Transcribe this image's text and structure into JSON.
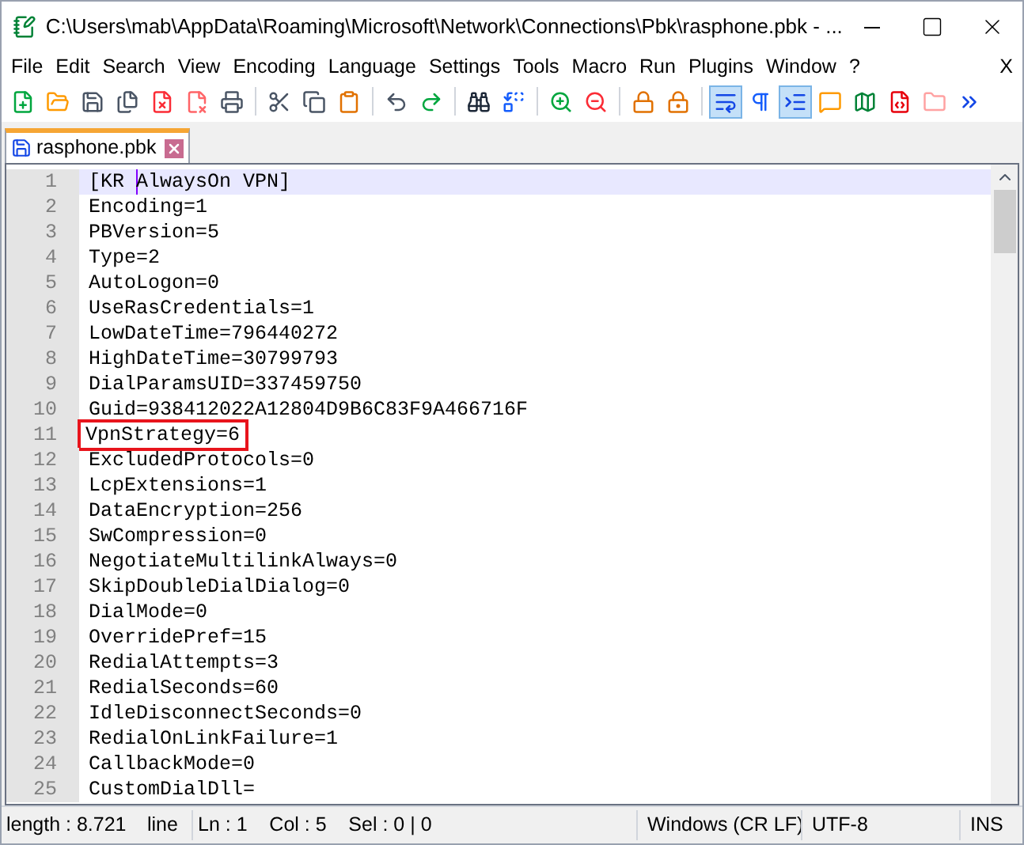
{
  "window": {
    "title": "C:\\Users\\mab\\AppData\\Roaming\\Microsoft\\Network\\Connections\\Pbk\\rasphone.pbk - ..."
  },
  "menu": [
    "File",
    "Edit",
    "Search",
    "View",
    "Encoding",
    "Language",
    "Settings",
    "Tools",
    "Macro",
    "Run",
    "Plugins",
    "Window",
    "?"
  ],
  "menu_close": "X",
  "toolbar": [
    {
      "kind": "new",
      "pressed": false
    },
    {
      "kind": "open",
      "pressed": false
    },
    {
      "kind": "save",
      "pressed": false
    },
    {
      "kind": "save-all",
      "pressed": false
    },
    {
      "kind": "close",
      "pressed": false
    },
    {
      "kind": "close-all",
      "pressed": false
    },
    {
      "kind": "print",
      "pressed": false
    },
    {
      "kind": "separator"
    },
    {
      "kind": "cut",
      "pressed": false
    },
    {
      "kind": "copy",
      "pressed": false
    },
    {
      "kind": "paste",
      "pressed": false
    },
    {
      "kind": "separator"
    },
    {
      "kind": "undo",
      "pressed": false
    },
    {
      "kind": "redo",
      "pressed": false
    },
    {
      "kind": "separator"
    },
    {
      "kind": "find",
      "pressed": false
    },
    {
      "kind": "replace",
      "pressed": false
    },
    {
      "kind": "separator"
    },
    {
      "kind": "zoom-in",
      "pressed": false
    },
    {
      "kind": "zoom-out",
      "pressed": false
    },
    {
      "kind": "separator"
    },
    {
      "kind": "sync-v",
      "pressed": false
    },
    {
      "kind": "sync-h",
      "pressed": false
    },
    {
      "kind": "separator"
    },
    {
      "kind": "wrap",
      "pressed": true
    },
    {
      "kind": "pilcrow",
      "pressed": false
    },
    {
      "kind": "indent",
      "pressed": true
    },
    {
      "kind": "lang",
      "pressed": false
    },
    {
      "kind": "map",
      "pressed": false
    },
    {
      "kind": "function",
      "pressed": false
    },
    {
      "kind": "folder",
      "pressed": false
    },
    {
      "kind": "more",
      "pressed": false
    }
  ],
  "tabs": [
    {
      "label": "rasphone.pbk",
      "selected": true
    }
  ],
  "lines": [
    {
      "number": "1",
      "text": "[KR AlwaysOn VPN]",
      "current": true,
      "boxed": false
    },
    {
      "number": "2",
      "text": "Encoding=1",
      "current": false,
      "boxed": false
    },
    {
      "number": "3",
      "text": "PBVersion=5",
      "current": false,
      "boxed": false
    },
    {
      "number": "4",
      "text": "Type=2",
      "current": false,
      "boxed": false
    },
    {
      "number": "5",
      "text": "AutoLogon=0",
      "current": false,
      "boxed": false
    },
    {
      "number": "6",
      "text": "UseRasCredentials=1",
      "current": false,
      "boxed": false
    },
    {
      "number": "7",
      "text": "LowDateTime=796440272",
      "current": false,
      "boxed": false
    },
    {
      "number": "8",
      "text": "HighDateTime=30799793",
      "current": false,
      "boxed": false
    },
    {
      "number": "9",
      "text": "DialParamsUID=337459750",
      "current": false,
      "boxed": false
    },
    {
      "number": "10",
      "text": "Guid=938412022A12804D9B6C83F9A466716F",
      "current": false,
      "boxed": false
    },
    {
      "number": "11",
      "text": "VpnStrategy=6",
      "current": false,
      "boxed": true
    },
    {
      "number": "12",
      "text": "ExcludedProtocols=0",
      "current": false,
      "boxed": false
    },
    {
      "number": "13",
      "text": "LcpExtensions=1",
      "current": false,
      "boxed": false
    },
    {
      "number": "14",
      "text": "DataEncryption=256",
      "current": false,
      "boxed": false
    },
    {
      "number": "15",
      "text": "SwCompression=0",
      "current": false,
      "boxed": false
    },
    {
      "number": "16",
      "text": "NegotiateMultilinkAlways=0",
      "current": false,
      "boxed": false
    },
    {
      "number": "17",
      "text": "SkipDoubleDialDialog=0",
      "current": false,
      "boxed": false
    },
    {
      "number": "18",
      "text": "DialMode=0",
      "current": false,
      "boxed": false
    },
    {
      "number": "19",
      "text": "OverridePref=15",
      "current": false,
      "boxed": false
    },
    {
      "number": "20",
      "text": "RedialAttempts=3",
      "current": false,
      "boxed": false
    },
    {
      "number": "21",
      "text": "RedialSeconds=60",
      "current": false,
      "boxed": false
    },
    {
      "number": "22",
      "text": "IdleDisconnectSeconds=0",
      "current": false,
      "boxed": false
    },
    {
      "number": "23",
      "text": "RedialOnLinkFailure=1",
      "current": false,
      "boxed": false
    },
    {
      "number": "24",
      "text": "CallbackMode=0",
      "current": false,
      "boxed": false
    },
    {
      "number": "25",
      "text": "CustomDialDll=",
      "current": false,
      "boxed": false
    }
  ],
  "status_bar": {
    "length": "length : 8.721",
    "lines": "line",
    "position": "Ln : 1    Col : 5    Sel : 0 | 0",
    "eol": "Windows (CR LF)",
    "encoding": "UTF-8",
    "mode": "INS"
  }
}
